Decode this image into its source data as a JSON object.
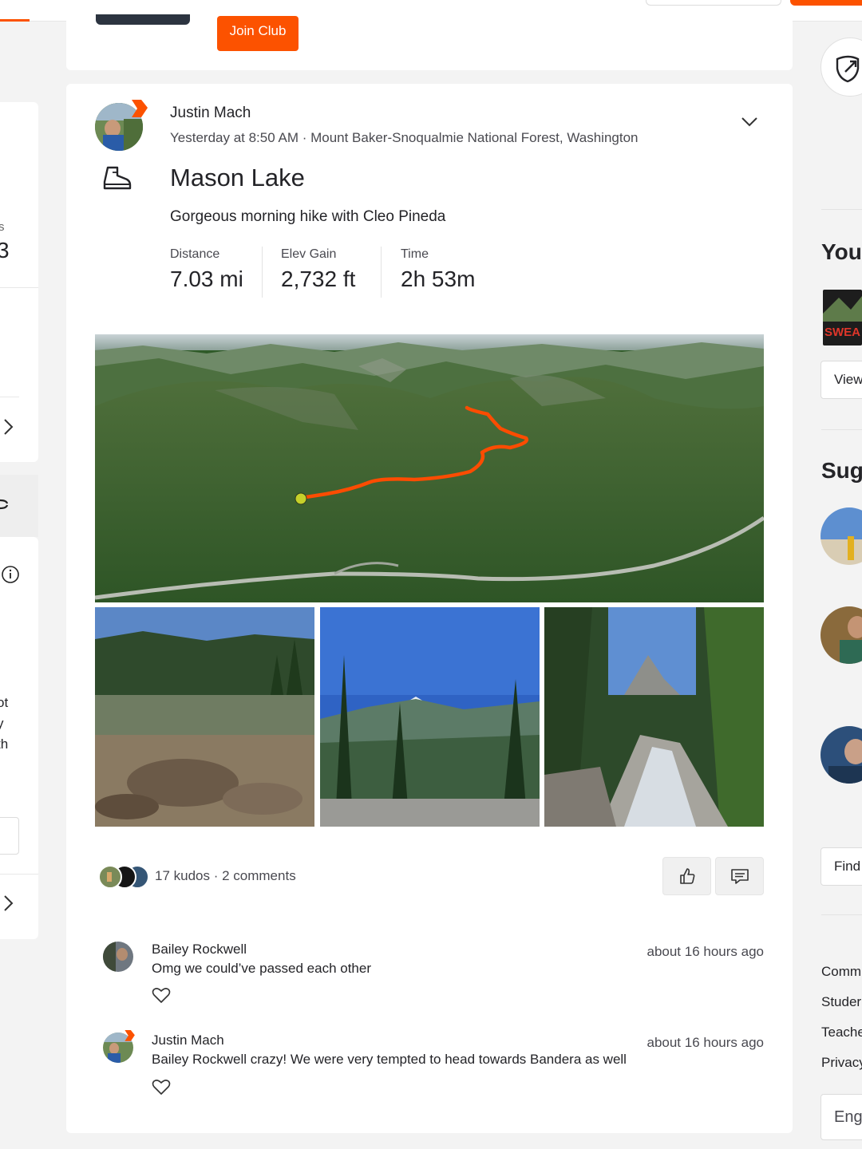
{
  "club": {
    "join_label": "Join Club"
  },
  "left": {
    "stat_label_fragment": "s",
    "stat_value_fragment": "3",
    "text_fragments": [
      "ot",
      "y",
      "th"
    ]
  },
  "activity": {
    "athlete": "Justin Mach",
    "meta": "Yesterday at 8:50 AM · Mount Baker-Snoqualmie National Forest, Washington",
    "title": "Mason Lake",
    "description_prefix": "Gorgeous morning hike with ",
    "tagged_athlete": "Cleo Pineda",
    "stats": [
      {
        "label": "Distance",
        "value": "7.03 mi"
      },
      {
        "label": "Elev Gain",
        "value": "2,732 ft"
      },
      {
        "label": "Time",
        "value": "2h 53m"
      }
    ],
    "kudos_summary": "17 kudos · 2 comments"
  },
  "comments": [
    {
      "name": "Bailey Rockwell",
      "text": "Omg we could’ve passed each other",
      "time": "about 16 hours ago"
    },
    {
      "name": "Justin Mach",
      "mention": "Bailey Rockwell",
      "text": " crazy! We were very tempted to head towards Bandera as well",
      "time": "about 16 hours ago"
    }
  ],
  "right": {
    "heading_your": "You",
    "view_label": "View",
    "heading_suggested": "Sug",
    "find_label": "Find",
    "footer_links": [
      "Comm",
      "Studer",
      "Teache",
      "Privacy"
    ],
    "language": "Eng"
  },
  "colors": {
    "brand": "#fc5200",
    "route": "#fc4c02",
    "text": "#242428"
  }
}
